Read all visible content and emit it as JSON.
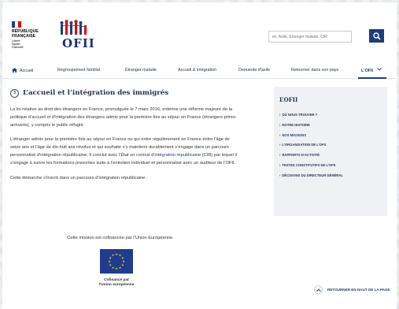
{
  "header": {
    "republique": [
      "RÉPUBLIQUE",
      "FRANÇAISE"
    ],
    "motto": [
      "Liberté",
      "Égalité",
      "Fraternité"
    ],
    "brand": "OFII",
    "search_placeholder": "ex: Asile, Étranger malade, CIR",
    "colors": {
      "navy": "#1f3d7a",
      "red": "#e1000f"
    }
  },
  "nav": {
    "items": [
      {
        "label": "Accueil",
        "icon": "home-icon"
      },
      {
        "label": "Regroupement familial"
      },
      {
        "label": "Étranger malade"
      },
      {
        "label": "Accueil & intégration"
      },
      {
        "label": "Demande d'asile"
      },
      {
        "label": "Retourner dans son pays"
      },
      {
        "label": "L'OFII",
        "active": true,
        "icon": "chevron-down-icon"
      }
    ]
  },
  "main": {
    "number": "3",
    "title": "L’accueil et l’intégration des immigrés",
    "para1": "La loi relative au droit des étrangers en France, promulguée le 7 mars 2016, entérine une réforme majeure de la politique d’accueil et d’intégration des étrangers admis pour la première fois au séjour en France (étrangers primo-arrivants), y compris le public réfugié.",
    "para2_before": "L’étranger admis pour la première fois au séjour en France ou qui entre régulièrement en France entre l’âge de seize ans et l’âge de dix-huit ans révolus et qui souhaite s’y maintenir durablement s’engage dans un parcours personnalisé d’intégration républicaine. Il conclut avec l’État un ",
    "para2_link": "contrat d’intégration républicaine",
    "para2_after": " (CIR) par lequel il s’engage à suivre les formations prescrites suite à l’entretien individuel et personnalisé avec un auditeur de l’OFII.",
    "para3": "Cette démarche s’inscrit dans un parcours d’intégration républicaine.",
    "cofinance": "Cette mission est cofinancée par l’Union Européenne.",
    "eu_caption": [
      "Cofinancé par",
      "l’Union européenne"
    ]
  },
  "sidebar": {
    "title": "L’OFII",
    "items": [
      {
        "label": "OÙ NOUS TROUVER ?"
      },
      {
        "label": "NOTRE HISTOIRE"
      },
      {
        "label": "NOS MISSIONS",
        "active": true
      },
      {
        "label": "L’ORGANISATION DE L’OFII"
      },
      {
        "label": "RAPPORTS D’ACTIVITÉ"
      },
      {
        "label": "TEXTES CONSTITUTIFS DE L’OFII"
      },
      {
        "label": "DÉCISIONS DU DIRECTEUR GÉNÉRAL"
      }
    ],
    "chevron": "›"
  },
  "back_to_top": "RETOURNER EN HAUT DE LA PAGE"
}
